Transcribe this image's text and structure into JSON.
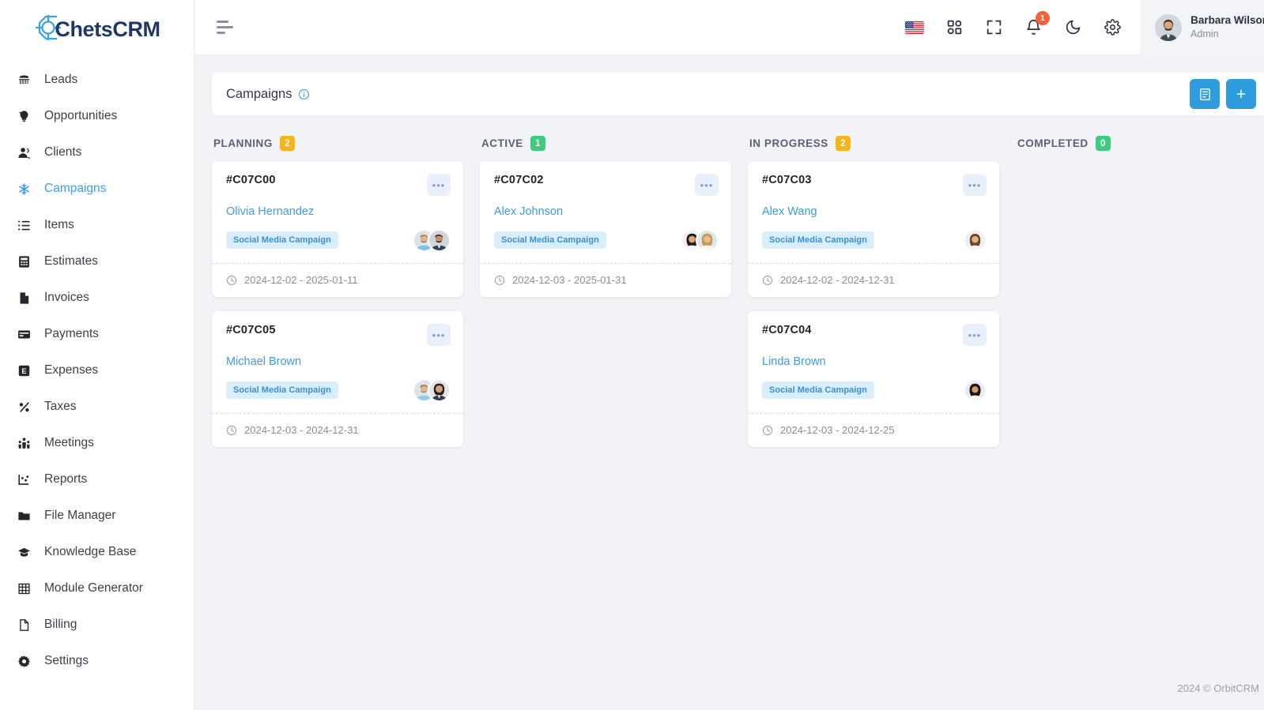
{
  "brand": {
    "name": "ChetsCRM",
    "logo_icon": "crosshair-target-icon",
    "accent": "#3ca0e7"
  },
  "sidebar": {
    "items": [
      {
        "label": "Leads",
        "icon": "telephone-icon",
        "active": false
      },
      {
        "label": "Opportunities",
        "icon": "lightbulb-icon",
        "active": false
      },
      {
        "label": "Clients",
        "icon": "user-icon",
        "active": false
      },
      {
        "label": "Campaigns",
        "icon": "asterisk-icon",
        "active": true
      },
      {
        "label": "Items",
        "icon": "list-icon",
        "active": false
      },
      {
        "label": "Estimates",
        "icon": "calculator-icon",
        "active": false
      },
      {
        "label": "Invoices",
        "icon": "file-icon",
        "active": false
      },
      {
        "label": "Payments",
        "icon": "credit-card-icon",
        "active": false
      },
      {
        "label": "Expenses",
        "icon": "expense-e-icon",
        "active": false
      },
      {
        "label": "Taxes",
        "icon": "percent-icon",
        "active": false
      },
      {
        "label": "Meetings",
        "icon": "people-group-icon",
        "active": false
      },
      {
        "label": "Reports",
        "icon": "chart-scatter-icon",
        "active": false
      },
      {
        "label": "File Manager",
        "icon": "folder-icon",
        "active": false
      },
      {
        "label": "Knowledge Base",
        "icon": "graduation-cap-icon",
        "active": false
      },
      {
        "label": "Module Generator",
        "icon": "grid-table-icon",
        "active": false
      },
      {
        "label": "Billing",
        "icon": "document-icon",
        "active": false
      },
      {
        "label": "Settings",
        "icon": "gear-icon",
        "active": false
      }
    ]
  },
  "topbar": {
    "menu_icon": "hamburger-menu-icon",
    "icons": [
      {
        "name": "language-flag-us-icon",
        "label": ""
      },
      {
        "name": "apps-grid-icon",
        "label": ""
      },
      {
        "name": "fullscreen-icon",
        "label": ""
      },
      {
        "name": "notification-bell-icon",
        "label": ""
      },
      {
        "name": "dark-mode-moon-icon",
        "label": ""
      },
      {
        "name": "settings-gear-icon",
        "label": ""
      }
    ],
    "notification_count": "1",
    "profile": {
      "name": "Barbara Wilson",
      "role": "Admin",
      "avatar": "user-avatar"
    }
  },
  "page": {
    "title": "Campaigns",
    "info_icon": "info-circle-icon",
    "actions": [
      {
        "name": "list-view-button",
        "glyph": "▤"
      },
      {
        "name": "add-campaign-button",
        "glyph": "+"
      }
    ]
  },
  "board": {
    "columns": [
      {
        "title": "PLANNING",
        "count": "2",
        "count_color": "#f5b game",
        "badge_color": "#f8b319",
        "cards": [
          {
            "code": "#C07C00",
            "person": "Olivia Hernandez",
            "tag": "Social Media Campaign",
            "dates": "2024-12-02 - 2025-01-11",
            "avatars": [
              "avatar-male-beard",
              "avatar-male-dark"
            ]
          },
          {
            "code": "#C07C05",
            "person": "Michael Brown",
            "tag": "Social Media Campaign",
            "dates": "2024-12-03 - 2024-12-31",
            "avatars": [
              "avatar-male-beard",
              "avatar-female-dark"
            ]
          }
        ]
      },
      {
        "title": "ACTIVE",
        "count": "1",
        "badge_color": "#3ccb7f",
        "cards": [
          {
            "code": "#C07C02",
            "person": "Alex Johnson",
            "tag": "Social Media Campaign",
            "dates": "2024-12-03 - 2025-01-31",
            "avatars": [
              "avatar-female-dark",
              "avatar-female-blonde"
            ]
          }
        ]
      },
      {
        "title": "IN PROGRESS",
        "count": "2",
        "badge_color": "#f8b319",
        "cards": [
          {
            "code": "#C07C03",
            "person": "Alex Wang",
            "tag": "Social Media Campaign",
            "dates": "2024-12-02 - 2024-12-31",
            "avatars": [
              "avatar-female-brown"
            ]
          },
          {
            "code": "#C07C04",
            "person": "Linda Brown",
            "tag": "Social Media Campaign",
            "dates": "2024-12-03 - 2024-12-25",
            "avatars": [
              "avatar-female-dark2"
            ]
          }
        ]
      },
      {
        "title": "COMPLETED",
        "count": "0",
        "badge_color": "#3ccb7f",
        "cards": []
      }
    ]
  },
  "footer": {
    "copyright": "2024 © OrbitCRM"
  }
}
